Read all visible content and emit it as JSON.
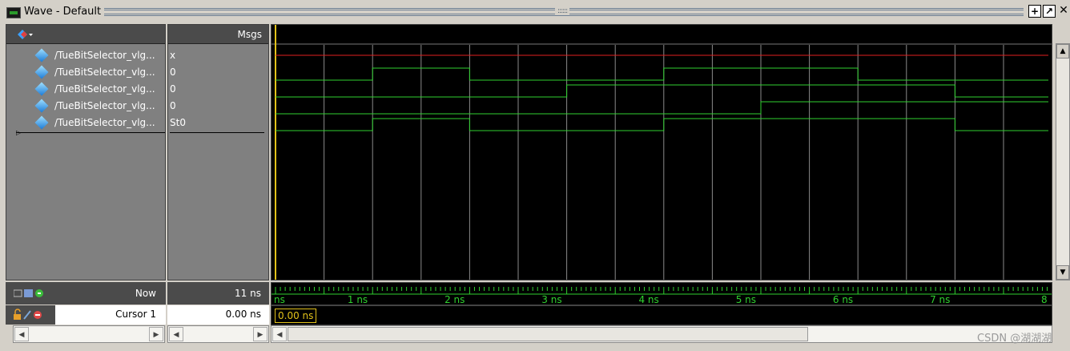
{
  "window": {
    "title": "Wave - Default",
    "grip": "::::::",
    "buttons": {
      "add": "+",
      "undock": "↗",
      "close": "✕"
    }
  },
  "header": {
    "msgs_label": "Msgs"
  },
  "signals": [
    {
      "name": "/TueBitSelector_vlg...",
      "value": "x"
    },
    {
      "name": "/TueBitSelector_vlg...",
      "value": "0"
    },
    {
      "name": "/TueBitSelector_vlg...",
      "value": "0"
    },
    {
      "name": "/TueBitSelector_vlg...",
      "value": "0"
    },
    {
      "name": "/TueBitSelector_vlg...",
      "value": "St0"
    }
  ],
  "bottom": {
    "now_label": "Now",
    "now_value": "11 ns",
    "cursor_label": "Cursor 1",
    "cursor_value": "0.00 ns",
    "cursor_marker": "0.00 ns"
  },
  "timeline": {
    "labels": [
      "ns",
      "1 ns",
      "2 ns",
      "3 ns",
      "4 ns",
      "5 ns",
      "6 ns",
      "7 ns",
      "8"
    ]
  },
  "colors": {
    "wave_green": "#2fd12f",
    "wave_red": "#e02020",
    "cursor_yellow": "#e2c21a",
    "grid": "#8a8a8a"
  },
  "waveforms": [
    {
      "kind": "x_red",
      "segments": []
    },
    {
      "kind": "digital",
      "levels": [
        0,
        1,
        0,
        0,
        1,
        1,
        0,
        0
      ]
    },
    {
      "kind": "digital",
      "levels": [
        0,
        0,
        0,
        1,
        1,
        1,
        1,
        0
      ]
    },
    {
      "kind": "digital",
      "levels": [
        0,
        0,
        0,
        0,
        0,
        1,
        1,
        1
      ]
    },
    {
      "kind": "digital",
      "levels": [
        0,
        1,
        0,
        0,
        1,
        1,
        1,
        0
      ]
    }
  ],
  "watermark": "CSDN @湖湖湖"
}
